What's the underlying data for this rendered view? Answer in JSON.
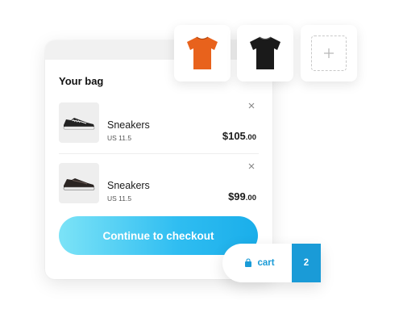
{
  "bag": {
    "title": "Your bag",
    "items": [
      {
        "name": "Sneakers",
        "size": "US 11.5",
        "price_main": "$105",
        "price_cents": ".00"
      },
      {
        "name": "Sneakers",
        "size": "US 11.5",
        "price_main": "$99",
        "price_cents": ".00"
      }
    ],
    "checkout_label": "Continue to checkout"
  },
  "variants": [
    {
      "icon": "orange-tshirt-icon",
      "color": "#e8621c"
    },
    {
      "icon": "black-tshirt-icon",
      "color": "#1a1a1a"
    },
    {
      "icon": "plus-icon"
    }
  ],
  "cart": {
    "label": "cart",
    "count": "2",
    "accent": "#1a9bd7"
  },
  "colors": {
    "checkout_gradient_start": "#7ce3f7",
    "checkout_gradient_end": "#1aaeea"
  }
}
